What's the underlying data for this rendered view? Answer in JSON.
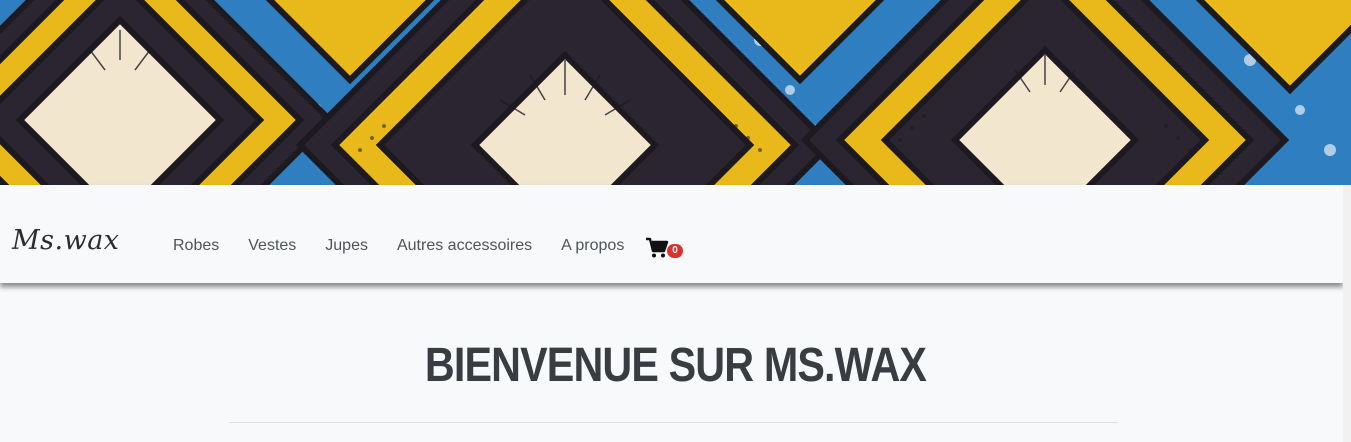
{
  "brand": {
    "logo_text": "Ms.wax"
  },
  "nav": {
    "items": [
      {
        "label": "Robes"
      },
      {
        "label": "Vestes"
      },
      {
        "label": "Jupes"
      },
      {
        "label": "Autres accessoires"
      },
      {
        "label": "A propos"
      }
    ],
    "cart": {
      "icon": "cart-icon",
      "count": "0"
    }
  },
  "main": {
    "title": "Bienvenue sur Ms.wax"
  },
  "colors": {
    "banner_yellow": "#e9b91c",
    "banner_dark": "#2a2530",
    "banner_blue": "#2f7fc0",
    "badge": "#e0302a"
  }
}
